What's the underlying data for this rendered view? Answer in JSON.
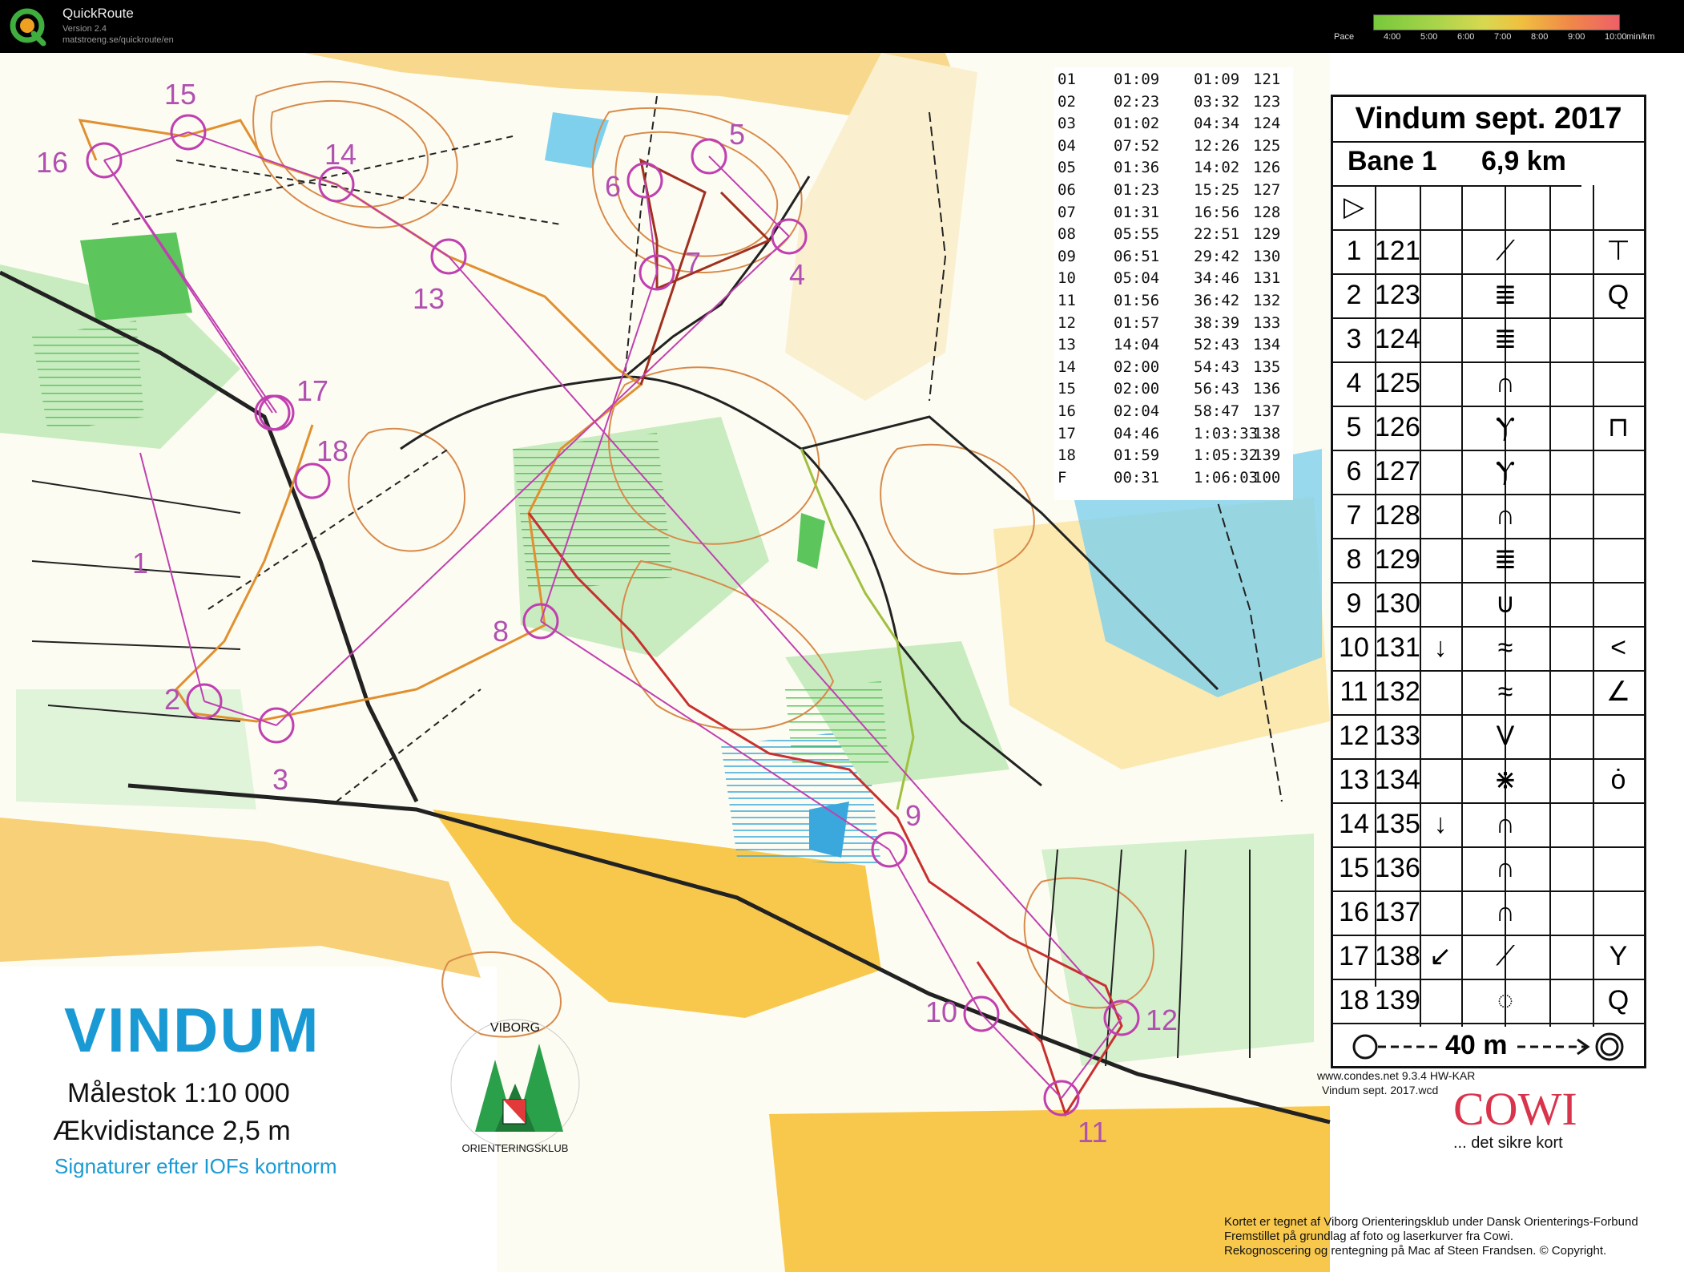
{
  "app": {
    "title": "QuickRoute",
    "version": "Version 2.4",
    "url": "matstroeng.se/quickroute/en",
    "pace_label": "Pace",
    "pace_ticks": [
      "4:00",
      "5:00",
      "6:00",
      "7:00",
      "8:00",
      "9:00",
      "10:00"
    ],
    "pace_unit": "min/km",
    "pace_colors": [
      "#78c83c",
      "#d8d850",
      "#f0c040",
      "#ee6068"
    ]
  },
  "splits": {
    "rows": [
      {
        "leg": "01",
        "split": "01:09",
        "total": "01:09",
        "code": "121"
      },
      {
        "leg": "02",
        "split": "02:23",
        "total": "03:32",
        "code": "123"
      },
      {
        "leg": "03",
        "split": "01:02",
        "total": "04:34",
        "code": "124"
      },
      {
        "leg": "04",
        "split": "07:52",
        "total": "12:26",
        "code": "125"
      },
      {
        "leg": "05",
        "split": "01:36",
        "total": "14:02",
        "code": "126"
      },
      {
        "leg": "06",
        "split": "01:23",
        "total": "15:25",
        "code": "127"
      },
      {
        "leg": "07",
        "split": "01:31",
        "total": "16:56",
        "code": "128"
      },
      {
        "leg": "08",
        "split": "05:55",
        "total": "22:51",
        "code": "129"
      },
      {
        "leg": "09",
        "split": "06:51",
        "total": "29:42",
        "code": "130"
      },
      {
        "leg": "10",
        "split": "05:04",
        "total": "34:46",
        "code": "131"
      },
      {
        "leg": "11",
        "split": "01:56",
        "total": "36:42",
        "code": "132"
      },
      {
        "leg": "12",
        "split": "01:57",
        "total": "38:39",
        "code": "133"
      },
      {
        "leg": "13",
        "split": "14:04",
        "total": "52:43",
        "code": "134"
      },
      {
        "leg": "14",
        "split": "02:00",
        "total": "54:43",
        "code": "135"
      },
      {
        "leg": "15",
        "split": "02:00",
        "total": "56:43",
        "code": "136"
      },
      {
        "leg": "16",
        "split": "02:04",
        "total": "58:47",
        "code": "137"
      },
      {
        "leg": "17",
        "split": "04:46",
        "total": "1:03:33",
        "code": "138"
      },
      {
        "leg": "18",
        "split": "01:59",
        "total": "1:05:32",
        "code": "139"
      },
      {
        "leg": "F",
        "split": "00:31",
        "total": "1:06:03",
        "code": "100"
      }
    ]
  },
  "description": {
    "title": "Vindum sept. 2017",
    "course": "Bane 1",
    "length": "6,9 km",
    "start_symbol": "▷",
    "controls": [
      {
        "num": "1",
        "code": "121",
        "dir": "",
        "feature": "⟋",
        "detail": "⊤"
      },
      {
        "num": "2",
        "code": "123",
        "dir": "",
        "feature": "≣",
        "detail": "Q"
      },
      {
        "num": "3",
        "code": "124",
        "dir": "",
        "feature": "≣",
        "detail": ""
      },
      {
        "num": "4",
        "code": "125",
        "dir": "",
        "feature": "∩",
        "detail": ""
      },
      {
        "num": "5",
        "code": "126",
        "dir": "",
        "feature": "Ⲩ",
        "detail": "⊓"
      },
      {
        "num": "6",
        "code": "127",
        "dir": "",
        "feature": "Ⲩ",
        "detail": ""
      },
      {
        "num": "7",
        "code": "128",
        "dir": "",
        "feature": "∩",
        "detail": ""
      },
      {
        "num": "8",
        "code": "129",
        "dir": "",
        "feature": "≣",
        "detail": ""
      },
      {
        "num": "9",
        "code": "130",
        "dir": "",
        "feature": "∪",
        "detail": ""
      },
      {
        "num": "10",
        "code": "131",
        "dir": "↓",
        "feature": "≈",
        "detail": "<"
      },
      {
        "num": "11",
        "code": "132",
        "dir": "",
        "feature": "≈",
        "detail": "∠"
      },
      {
        "num": "12",
        "code": "133",
        "dir": "",
        "feature": "V",
        "detail": ""
      },
      {
        "num": "13",
        "code": "134",
        "dir": "",
        "feature": "⋇",
        "detail": "ȯ"
      },
      {
        "num": "14",
        "code": "135",
        "dir": "↓",
        "feature": "∩",
        "detail": ""
      },
      {
        "num": "15",
        "code": "136",
        "dir": "",
        "feature": "∩",
        "detail": ""
      },
      {
        "num": "16",
        "code": "137",
        "dir": "",
        "feature": "∩",
        "detail": ""
      },
      {
        "num": "17",
        "code": "138",
        "dir": "↙",
        "feature": "⟋",
        "detail": "Y"
      },
      {
        "num": "18",
        "code": "139",
        "dir": "",
        "feature": "◌",
        "detail": "Q"
      }
    ],
    "finish": "40 m"
  },
  "map": {
    "title": "VINDUM",
    "scale": "Målestok  1:10 000",
    "contour": "Ækvidistance  2,5 m",
    "signature": "Signaturer efter IOFs kortnorm",
    "club_top": "VIBORG",
    "club_bottom": "ORIENTERINGSKLUB",
    "sponsor": "COWI",
    "sponsor_tagline": "... det sikre kort",
    "ocad_note": "www.condes.net 9.3.4 HW-KAR",
    "ocad_file": "Vindum sept. 2017.wcd",
    "credits": [
      "Kortet er tegnet af Viborg Orienteringsklub under Dansk Orienterings-Forbund",
      "Fremstillet på grundlag af foto og laserkurver fra Cowi.",
      "Rekognoscering og rentegning på Mac af Steen Frandsen. © Copyright."
    ],
    "control_labels": [
      "1",
      "2",
      "3",
      "4",
      "5",
      "6",
      "7",
      "8",
      "9",
      "10",
      "11",
      "12",
      "13",
      "14",
      "15",
      "16",
      "17",
      "18"
    ],
    "colors": {
      "forest_green": "#5cc65c",
      "light_green": "#c8ecc0",
      "open_yellow": "#f8c84c",
      "water_blue": "#7ed0ec",
      "course_purple": "#c040b0",
      "contour_brown": "#d88a4a",
      "road_black": "#222222"
    }
  }
}
